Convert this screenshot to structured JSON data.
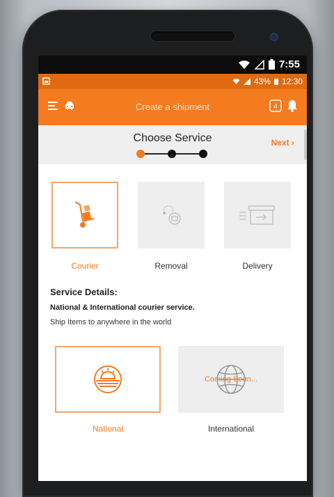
{
  "status_bar": {
    "time": "7:55"
  },
  "inner_status": {
    "battery": "43%",
    "time": "12:30"
  },
  "appbar": {
    "title": "Create a shipment",
    "badge": "4"
  },
  "stepper": {
    "title": "Choose Service",
    "next": "Next"
  },
  "services": [
    {
      "label": "Courier",
      "icon": "hand-truck-icon",
      "selected": true
    },
    {
      "label": "Removal",
      "icon": "removal-icon",
      "selected": false
    },
    {
      "label": "Delivery",
      "icon": "delivery-box-icon",
      "selected": false
    }
  ],
  "details": {
    "heading": "Service Details:",
    "line1": "National & International courier service.",
    "line2": "Ship Items to anywhere in the world"
  },
  "regions": [
    {
      "label": "National",
      "icon": "sun-horizon-icon",
      "selected": true
    },
    {
      "label": "International",
      "icon": "globe-icon",
      "selected": false,
      "overlay": "Coming Soon..."
    }
  ],
  "colors": {
    "accent": "#f47b20",
    "status_orange": "#e06a12",
    "panel_gray": "#eeeeee"
  }
}
